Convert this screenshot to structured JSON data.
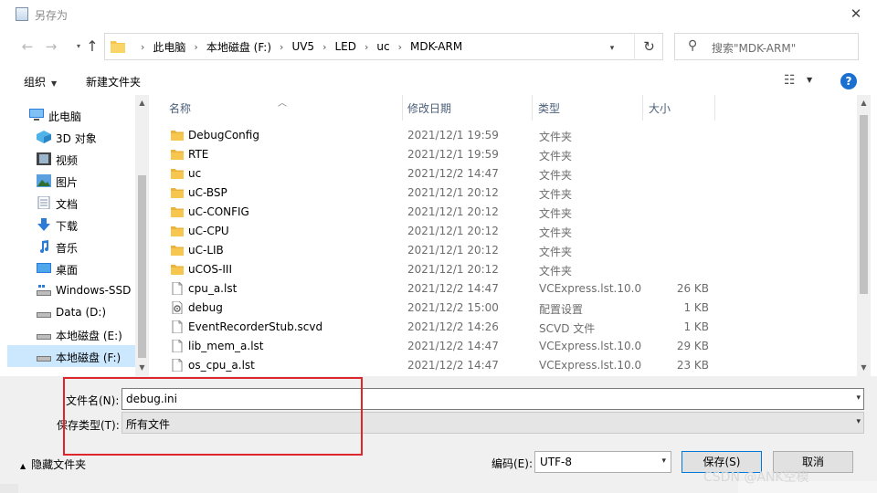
{
  "window": {
    "title": "另存为",
    "close": "✕"
  },
  "nav": {
    "back": "←",
    "forward": "→",
    "up": "↑",
    "refresh": "↻",
    "breadcrumbs": [
      "此电脑",
      "本地磁盘 (F:)",
      "UV5",
      "LED",
      "uc",
      "MDK-ARM"
    ],
    "search_placeholder": "搜索\"MDK-ARM\""
  },
  "toolbar": {
    "organize": "组织",
    "new_folder": "新建文件夹",
    "help": "?"
  },
  "sidebar": {
    "items": [
      {
        "label": "此电脑",
        "icon": "computer-icon"
      },
      {
        "label": "3D 对象",
        "icon": "3d-objects-icon"
      },
      {
        "label": "视频",
        "icon": "video-icon"
      },
      {
        "label": "图片",
        "icon": "pictures-icon"
      },
      {
        "label": "文档",
        "icon": "documents-icon"
      },
      {
        "label": "下载",
        "icon": "download-icon"
      },
      {
        "label": "音乐",
        "icon": "music-icon"
      },
      {
        "label": "桌面",
        "icon": "desktop-icon"
      },
      {
        "label": "Windows-SSD",
        "icon": "drive-icon"
      },
      {
        "label": "Data (D:)",
        "icon": "drive-icon"
      },
      {
        "label": "本地磁盘 (E:)",
        "icon": "drive-icon"
      },
      {
        "label": "本地磁盘 (F:)",
        "icon": "drive-icon",
        "selected": true
      }
    ]
  },
  "list": {
    "columns": {
      "name": "名称",
      "date": "修改日期",
      "type": "类型",
      "size": "大小"
    },
    "rows": [
      {
        "name": "DebugConfig",
        "date": "2021/12/1 19:59",
        "type": "文件夹",
        "size": "",
        "kind": "folder"
      },
      {
        "name": "RTE",
        "date": "2021/12/1 19:59",
        "type": "文件夹",
        "size": "",
        "kind": "folder"
      },
      {
        "name": "uc",
        "date": "2021/12/2 14:47",
        "type": "文件夹",
        "size": "",
        "kind": "folder"
      },
      {
        "name": "uC-BSP",
        "date": "2021/12/1 20:12",
        "type": "文件夹",
        "size": "",
        "kind": "folder"
      },
      {
        "name": "uC-CONFIG",
        "date": "2021/12/1 20:12",
        "type": "文件夹",
        "size": "",
        "kind": "folder"
      },
      {
        "name": "uC-CPU",
        "date": "2021/12/1 20:12",
        "type": "文件夹",
        "size": "",
        "kind": "folder"
      },
      {
        "name": "uC-LIB",
        "date": "2021/12/1 20:12",
        "type": "文件夹",
        "size": "",
        "kind": "folder"
      },
      {
        "name": "uCOS-III",
        "date": "2021/12/1 20:12",
        "type": "文件夹",
        "size": "",
        "kind": "folder"
      },
      {
        "name": "cpu_a.lst",
        "date": "2021/12/2 14:47",
        "type": "VCExpress.lst.10.0",
        "size": "26 KB",
        "kind": "file"
      },
      {
        "name": "debug",
        "date": "2021/12/2 15:00",
        "type": "配置设置",
        "size": "1 KB",
        "kind": "settings"
      },
      {
        "name": "EventRecorderStub.scvd",
        "date": "2021/12/2 14:26",
        "type": "SCVD 文件",
        "size": "1 KB",
        "kind": "file"
      },
      {
        "name": "lib_mem_a.lst",
        "date": "2021/12/2 14:47",
        "type": "VCExpress.lst.10.0",
        "size": "29 KB",
        "kind": "file"
      },
      {
        "name": "os_cpu_a.lst",
        "date": "2021/12/2 14:47",
        "type": "VCExpress.lst.10.0",
        "size": "23 KB",
        "kind": "file"
      }
    ]
  },
  "save": {
    "filename_label": "文件名(N):",
    "filename_value": "debug.ini",
    "filetype_label": "保存类型(T):",
    "filetype_value": "所有文件",
    "hide_folders": "隐藏文件夹",
    "encoding_label": "编码(E):",
    "encoding_value": "UTF-8",
    "save_button": "保存(S)",
    "cancel_button": "取消"
  },
  "watermark": "CSDN @ANK空模",
  "colors": {
    "selected": "#cce8ff",
    "highlight_box": "#e0262d",
    "accent": "#0078d7",
    "folder": "#f6c64e"
  }
}
